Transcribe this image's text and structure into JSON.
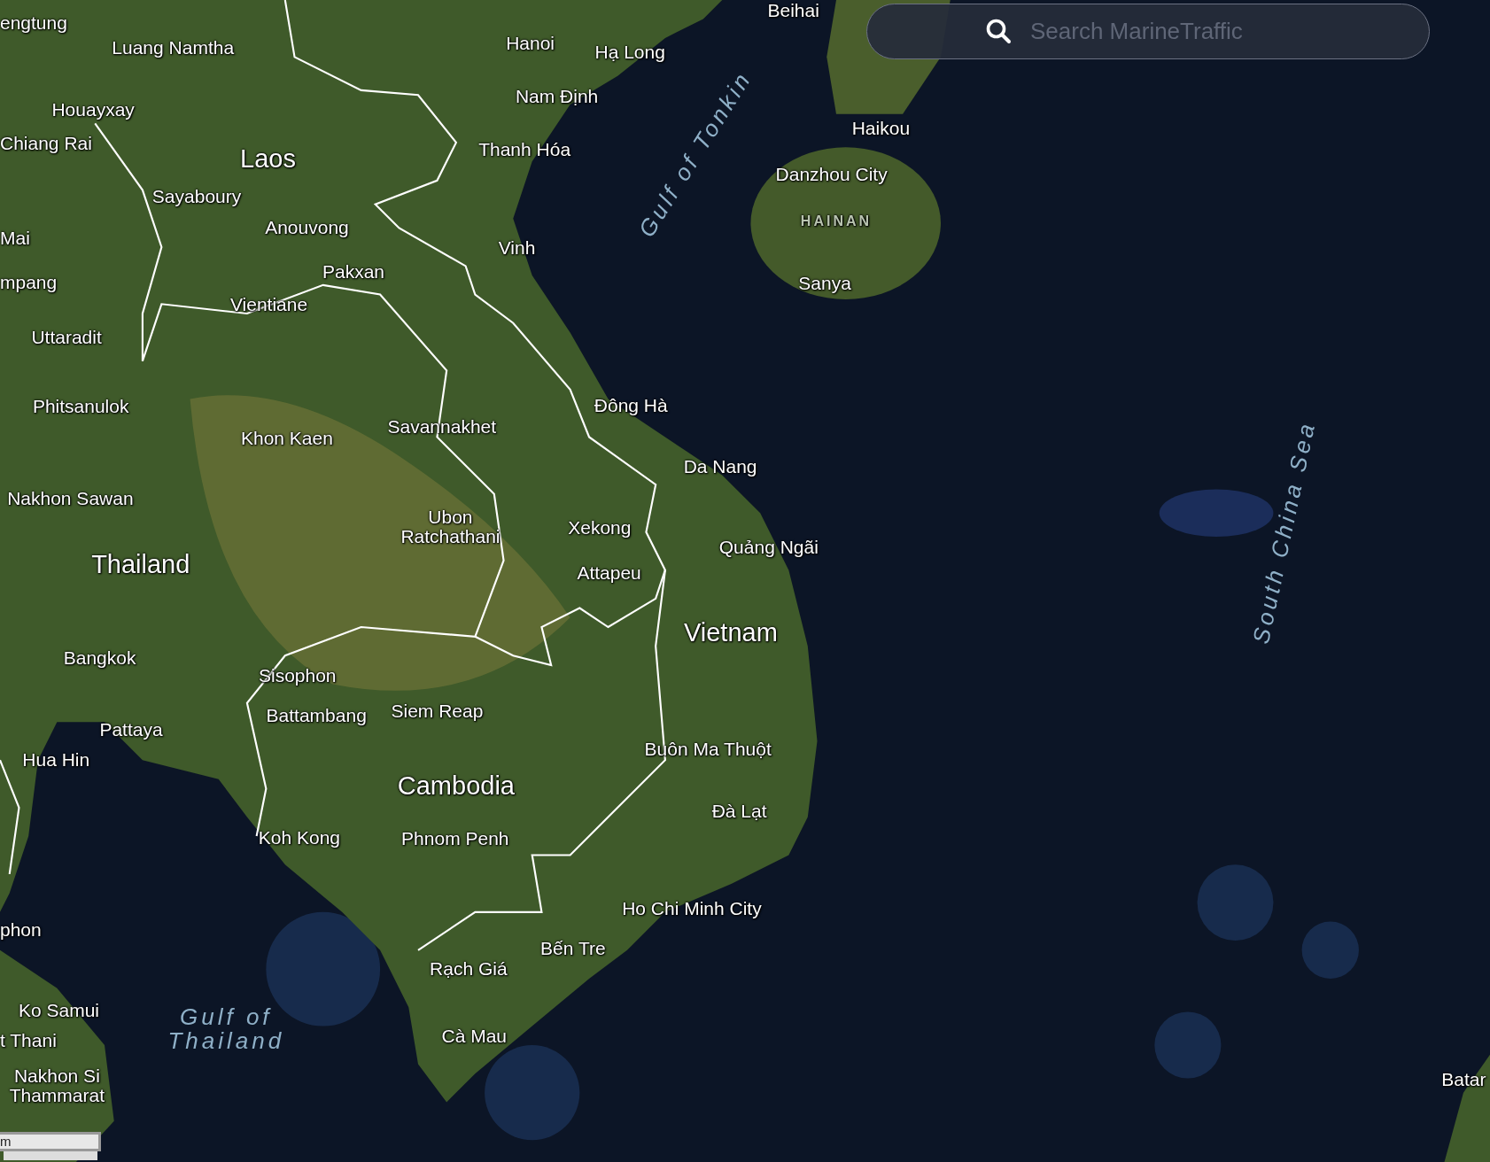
{
  "search": {
    "placeholder": "Search MarineTraffic"
  },
  "map": {
    "labels": [
      {
        "kind": "city",
        "text": "engtung"
      },
      {
        "kind": "city",
        "text": "Beihai"
      },
      {
        "kind": "city",
        "text": "Luang Namtha"
      },
      {
        "kind": "city",
        "text": "Hanoi"
      },
      {
        "kind": "city",
        "text": "Hạ Long"
      },
      {
        "kind": "city",
        "text": "Houayxay"
      },
      {
        "kind": "city",
        "text": "Nam Định"
      },
      {
        "kind": "city",
        "text": "Chiang Rai"
      },
      {
        "kind": "city",
        "text": "Thanh Hóa"
      },
      {
        "kind": "city",
        "text": "Haikou"
      },
      {
        "kind": "country",
        "text": "Laos"
      },
      {
        "kind": "city",
        "text": "Danzhou City"
      },
      {
        "kind": "sea",
        "text": "Gulf of Tonkin"
      },
      {
        "kind": "city",
        "text": "Sayaboury"
      },
      {
        "kind": "region",
        "text": "HAINAN"
      },
      {
        "kind": "city",
        "text": "Anouvong"
      },
      {
        "kind": "city",
        "text": "Mai"
      },
      {
        "kind": "city",
        "text": "Vinh"
      },
      {
        "kind": "city",
        "text": "Pakxan"
      },
      {
        "kind": "city",
        "text": "mpang"
      },
      {
        "kind": "city",
        "text": "Sanya"
      },
      {
        "kind": "city",
        "text": "Vientiane"
      },
      {
        "kind": "city",
        "text": "Uttaradit"
      },
      {
        "kind": "city",
        "text": "Phitsanulok"
      },
      {
        "kind": "city",
        "text": "Đông Hà"
      },
      {
        "kind": "city",
        "text": "Savannakhet"
      },
      {
        "kind": "city",
        "text": "Khon Kaen"
      },
      {
        "kind": "city",
        "text": "Da Nang"
      },
      {
        "kind": "city",
        "text": "Nakhon Sawan"
      },
      {
        "kind": "city",
        "text": "Ubon Ratchathani"
      },
      {
        "kind": "city",
        "text": "Xekong"
      },
      {
        "kind": "city",
        "text": "Quảng Ngãi"
      },
      {
        "kind": "sea",
        "text": "South China Sea"
      },
      {
        "kind": "country",
        "text": "Thailand"
      },
      {
        "kind": "city",
        "text": "Attapeu"
      },
      {
        "kind": "country",
        "text": "Vietnam"
      },
      {
        "kind": "city",
        "text": "Bangkok"
      },
      {
        "kind": "city",
        "text": "Sisophon"
      },
      {
        "kind": "city",
        "text": "Battambang"
      },
      {
        "kind": "city",
        "text": "Siem Reap"
      },
      {
        "kind": "city",
        "text": "Pattaya"
      },
      {
        "kind": "city",
        "text": "Buôn Ma Thuột"
      },
      {
        "kind": "city",
        "text": "Hua Hin"
      },
      {
        "kind": "country",
        "text": "Cambodia"
      },
      {
        "kind": "city",
        "text": "Đà Lạt"
      },
      {
        "kind": "city",
        "text": "Koh Kong"
      },
      {
        "kind": "city",
        "text": "Phnom Penh"
      },
      {
        "kind": "city",
        "text": "Ho Chi Minh City"
      },
      {
        "kind": "city",
        "text": "phon"
      },
      {
        "kind": "city",
        "text": "Bến Tre"
      },
      {
        "kind": "city",
        "text": "Rạch Giá"
      },
      {
        "kind": "city",
        "text": "Ko Samui"
      },
      {
        "kind": "city",
        "text": "t Thani"
      },
      {
        "kind": "sea",
        "text": "Gulf of Thailand"
      },
      {
        "kind": "city",
        "text": "Cà Mau"
      },
      {
        "kind": "city",
        "text": "Nakhon Si Thammarat"
      },
      {
        "kind": "city",
        "text": "Batar"
      }
    ],
    "scale_bar": {
      "text": "m"
    }
  }
}
